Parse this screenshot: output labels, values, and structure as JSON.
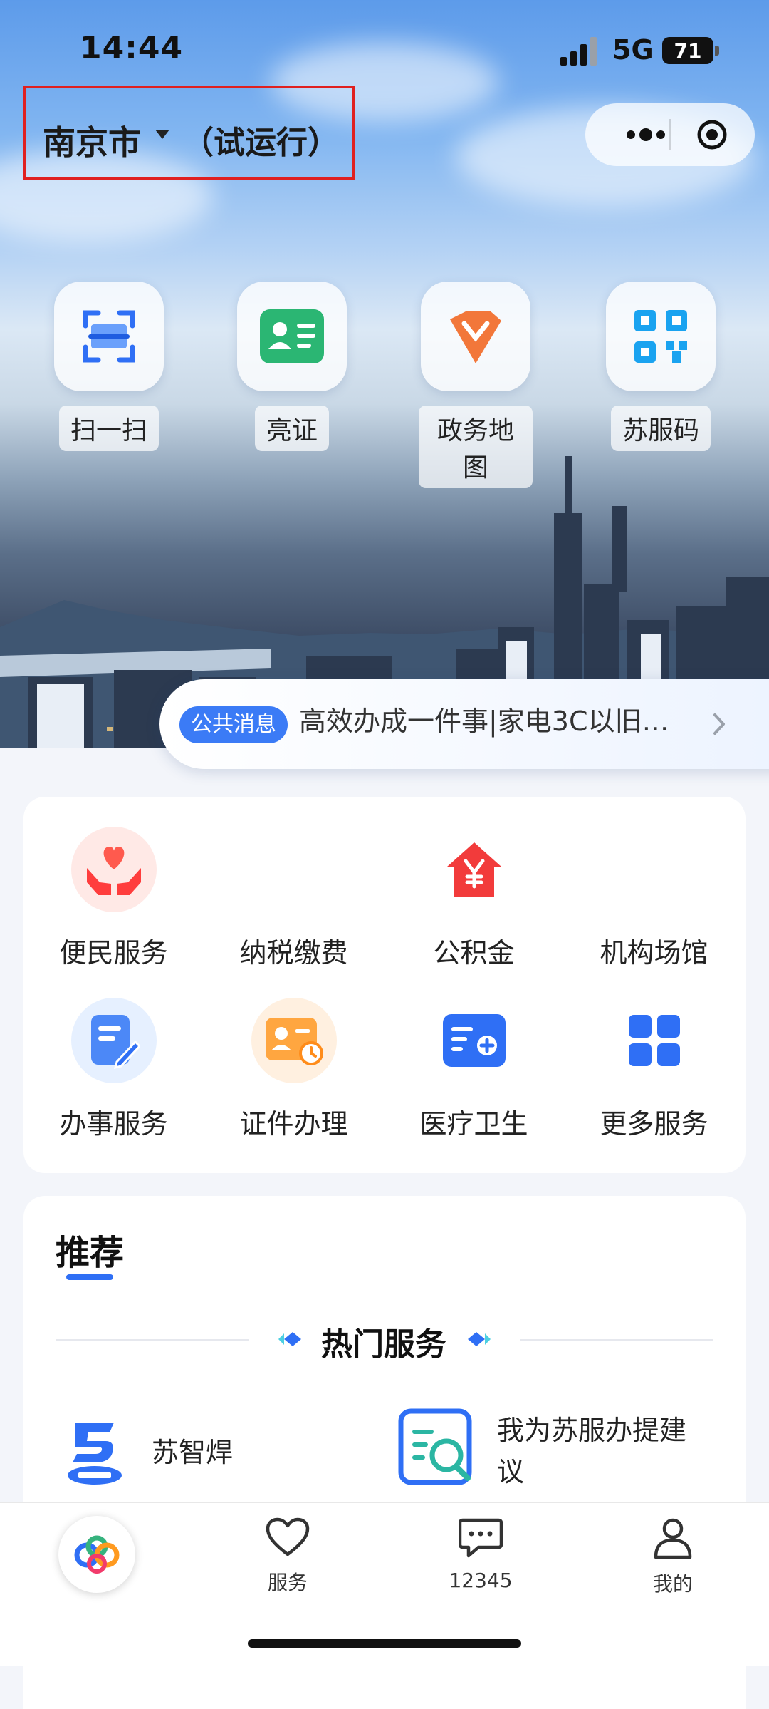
{
  "status_bar": {
    "time": "14:44",
    "network": "5G",
    "battery": "71"
  },
  "header": {
    "city": "南京市",
    "trial": "（试运行）"
  },
  "quick_actions": [
    {
      "label": "扫一扫",
      "icon": "scan-icon"
    },
    {
      "label": "亮证",
      "icon": "id-card-icon"
    },
    {
      "label": "政务地图",
      "icon": "map-pin-icon"
    },
    {
      "label": "苏服码",
      "icon": "qr-code-icon"
    }
  ],
  "notice": {
    "tag": "公共消息",
    "text": "高效办成一件事|家电3C以旧…"
  },
  "services": [
    {
      "label": "便民服务",
      "icon": "heart-hands-icon"
    },
    {
      "label": "纳税缴费",
      "icon": ""
    },
    {
      "label": "公积金",
      "icon": "house-yuan-icon"
    },
    {
      "label": "机构场馆",
      "icon": ""
    },
    {
      "label": "办事服务",
      "icon": "document-edit-icon"
    },
    {
      "label": "证件办理",
      "icon": "certificate-icon"
    },
    {
      "label": "医疗卫生",
      "icon": "medical-card-icon"
    },
    {
      "label": "更多服务",
      "icon": "grid-icon"
    }
  ],
  "recommend": {
    "title": "推荐",
    "section_title": "热门服务",
    "items": [
      {
        "label": "苏智焊",
        "icon": "suzhihan-logo-icon"
      },
      {
        "label": "我为苏服办提建议",
        "icon": "feedback-search-icon"
      }
    ]
  },
  "tabbar": [
    {
      "label": "",
      "icon": "home-logo-icon"
    },
    {
      "label": "服务",
      "icon": "heart-outline-icon"
    },
    {
      "label": "12345",
      "icon": "chat-bubble-icon"
    },
    {
      "label": "我的",
      "icon": "user-icon"
    }
  ],
  "colors": {
    "accent": "#3b7bf6",
    "highlight_box": "#e02020",
    "background": "#f3f5fa"
  }
}
